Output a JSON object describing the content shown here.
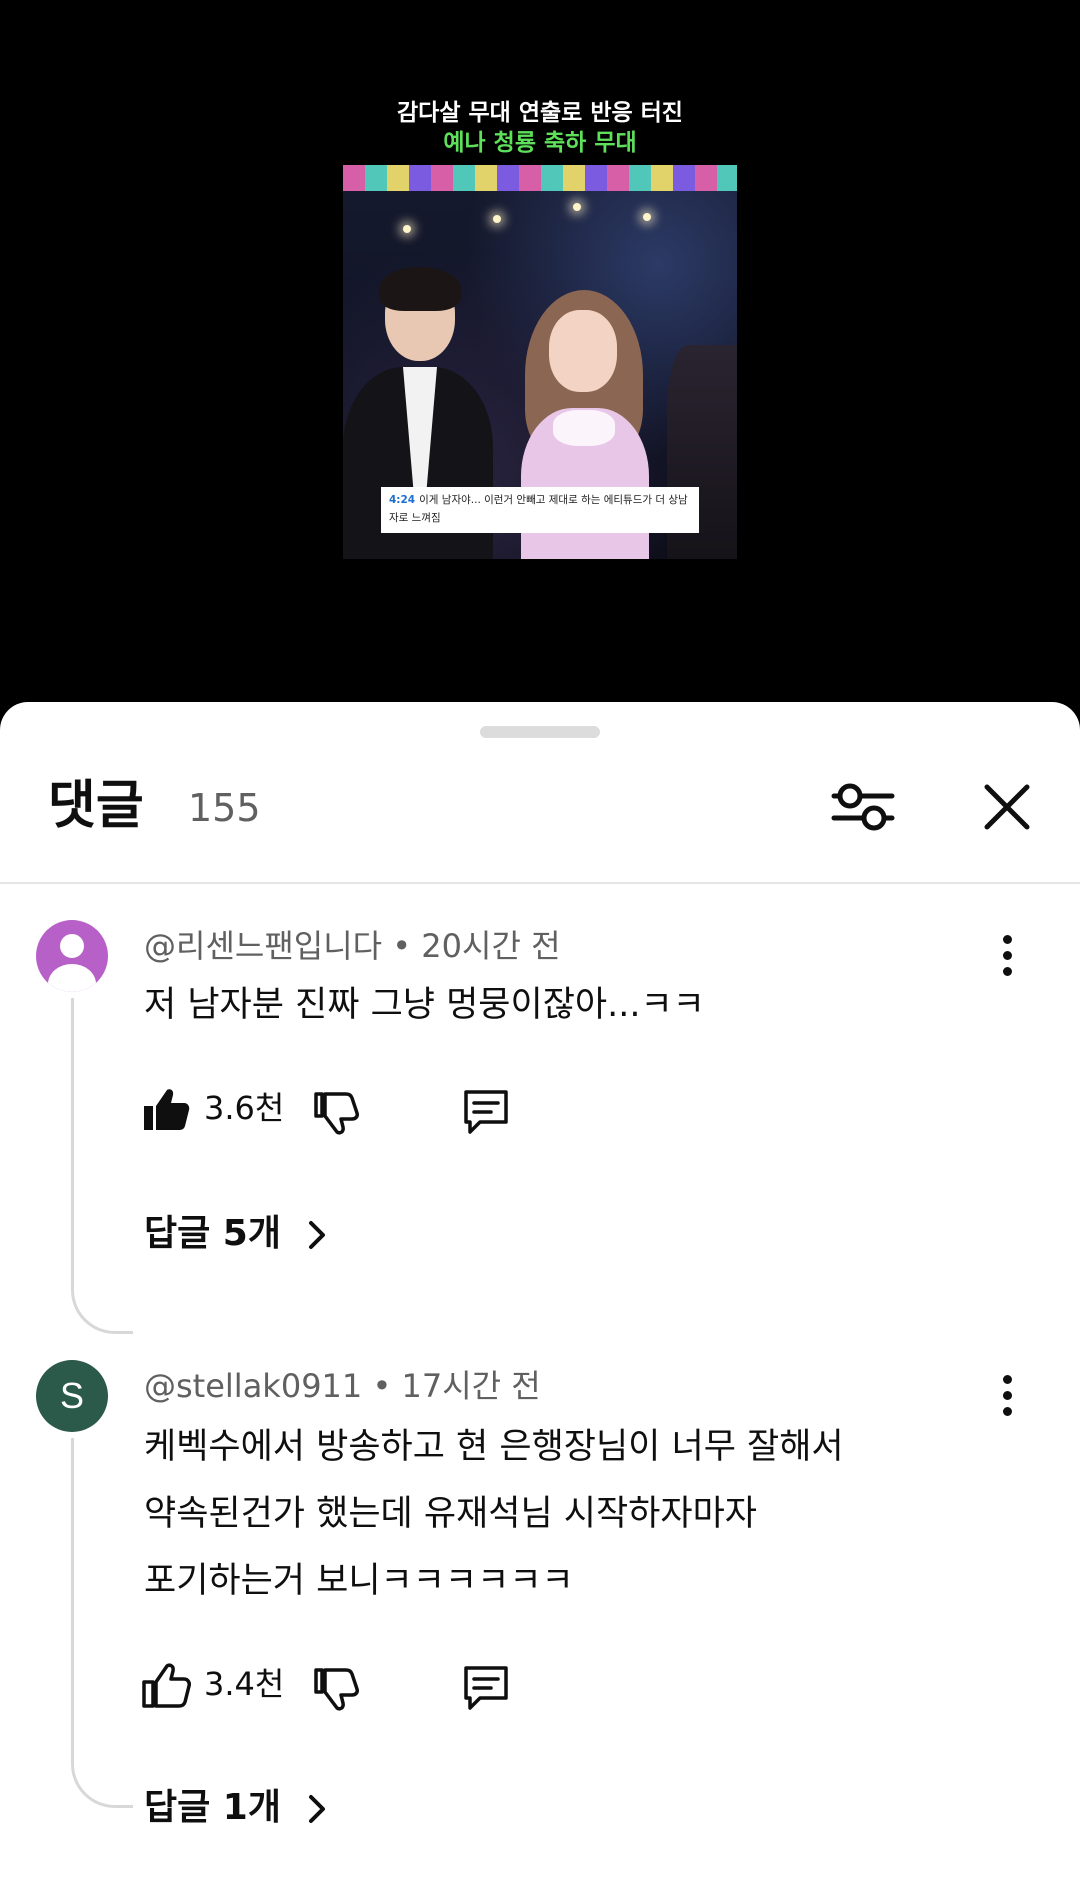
{
  "video": {
    "caption_line1": "감다살 무대 연출로 반응 터진",
    "caption_line2": "예나 청룡 축하 무대",
    "subtitle_time": "4:24",
    "subtitle_text": "이게 남자야... 이런거 안빼고 제대로 하는 에티튜드가 더 상남자로 느껴짐",
    "colors": {
      "caption_highlight": "#5ee05a",
      "subtitle_time": "#1e6fd0"
    }
  },
  "sheet": {
    "title": "댓글",
    "count": "155",
    "filter_icon": "sliders-icon",
    "close_icon": "close-icon"
  },
  "comments": [
    {
      "avatar": "person-icon",
      "avatar_color": "#b760c8",
      "meta": "@리센느팬입니다 • 20시간 전",
      "lines": [
        "저 남자분 진짜 그냥 멍뭉이잖아...ㅋㅋ"
      ],
      "likes": "3.6천",
      "liked": true,
      "replies": "답글 5개"
    },
    {
      "avatar_letter": "S",
      "avatar_color": "#2b5a4a",
      "meta": "@stellak0911 • 17시간 전",
      "lines": [
        "케벡수에서 방송하고 현 은행장님이 너무 잘해서",
        "약속된건가 했는데 유재석님 시작하자마자",
        "포기하는거 보니ㅋㅋㅋㅋㅋㅋ"
      ],
      "likes": "3.4천",
      "liked": false,
      "replies": "답글 1개"
    }
  ]
}
